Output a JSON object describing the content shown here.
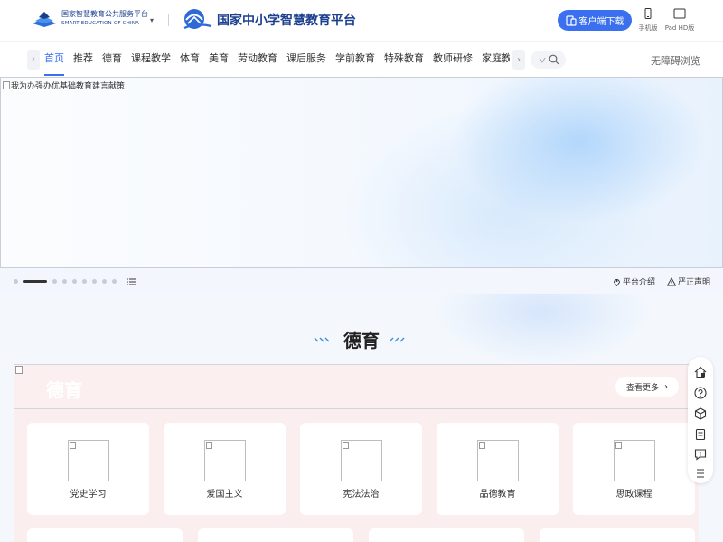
{
  "header": {
    "logo1_cn": "国家智慧教育公共服务平台",
    "logo1_en": "SMART EDUCATION OF CHINA",
    "platform_title": "国家中小学智慧教育平台",
    "download_label": "客户端下载",
    "mobile_label": "手机版",
    "pad_label": "Pad HD版"
  },
  "nav": {
    "items": [
      "首页",
      "推荐",
      "德育",
      "课程教学",
      "体育",
      "美育",
      "劳动教育",
      "课后服务",
      "学前教育",
      "特殊教育",
      "教师研修",
      "家庭教育",
      "教"
    ],
    "active_index": 0,
    "accessible_label": "无障碍浏览"
  },
  "banner": {
    "alt_text": "我为办强办优基础教育建言献策"
  },
  "carousel": {
    "slide_count": 9,
    "active_index": 1,
    "platform_intro": "平台介绍",
    "statement": "严正声明"
  },
  "section": {
    "title": "德育",
    "banner_title": "德育",
    "more_label": "查看更多",
    "cards": [
      "党史学习",
      "爱国主义",
      "宪法法治",
      "品德教育",
      "思政课程"
    ]
  },
  "colors": {
    "accent": "#3a6ff0",
    "brand_dark": "#1d3f8f",
    "section_pink": "#fbeeee"
  }
}
